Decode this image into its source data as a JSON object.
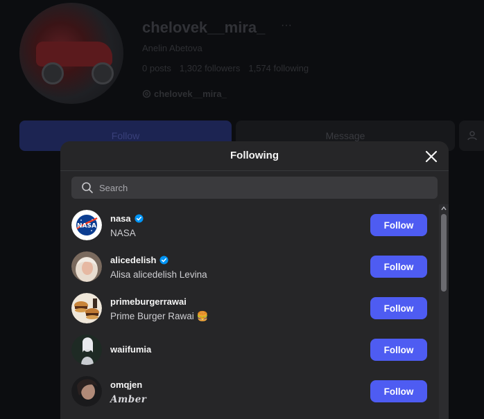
{
  "profile": {
    "username": "chelovek__mira_",
    "more": "···",
    "full_name": "Anelin Abetova",
    "stats": {
      "posts": "0 posts",
      "followers": "1,302 followers",
      "following": "1,574 following"
    },
    "threads_handle": "chelovek__mira_",
    "follow_label": "Follow",
    "message_label": "Message"
  },
  "modal": {
    "title": "Following",
    "search_placeholder": "Search",
    "follow_color": "#4e5cf2",
    "accounts": [
      {
        "username": "nasa",
        "verified": true,
        "subtitle": "NASA",
        "button": "Follow"
      },
      {
        "username": "alicedelish",
        "verified": true,
        "subtitle": "Alisa alicedelish Levina",
        "button": "Follow"
      },
      {
        "username": "primeburgerrawai",
        "verified": false,
        "subtitle": "Prime Burger Rawai 🍔",
        "button": "Follow"
      },
      {
        "username": "waiifumia",
        "verified": false,
        "subtitle": "",
        "button": "Follow"
      },
      {
        "username": "omqjen",
        "verified": false,
        "subtitle": "𝑨𝒎𝒃𝒆𝒓",
        "button": "Follow"
      }
    ]
  },
  "icons": {
    "close": "close-icon",
    "search": "search-icon",
    "verified": "verified-badge-icon",
    "threads": "threads-icon",
    "add_user": "add-user-icon"
  }
}
